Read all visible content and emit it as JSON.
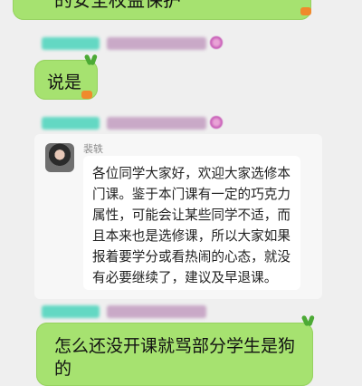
{
  "messages": {
    "top_partial": "的安全权益保护",
    "reply": "说是",
    "forwarded": {
      "sender": "裴轶",
      "lines": [
        "各位同学大家好，欢迎大家选修本",
        "门课。鉴于本门课有一定的巧克力",
        "属性，可能会让某些同学不适，而",
        "且本来也是选修课，所以大家如果",
        "报着要学分或看热闹的心态，就没",
        "有必要继续了，建议及早退课。"
      ]
    },
    "bottom_line1": "怎么还没开课就骂部分学生是狗",
    "bottom_line2": "的"
  },
  "colors": {
    "bubble_green": "#a6e270",
    "background": "#efefef"
  },
  "icons": [
    "carrot-sticker-icon",
    "blurred-flower-emoji-icon",
    "avatar"
  ]
}
